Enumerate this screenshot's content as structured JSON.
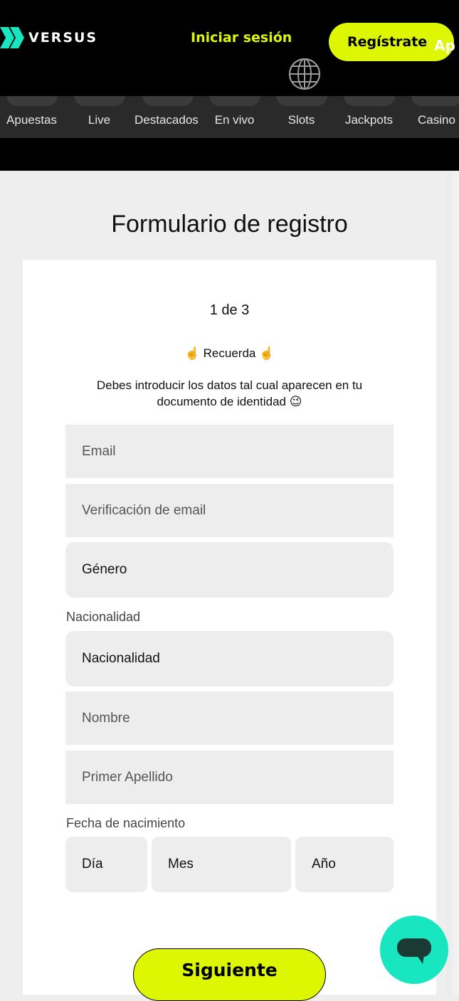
{
  "header": {
    "logo_text": "VERSUS",
    "login_label": "Iniciar sesión",
    "register_label": "Regístrate",
    "app_clip": "Ap",
    "brand_color": "#ddf702"
  },
  "nav": {
    "items": [
      {
        "label": "Apuestas"
      },
      {
        "label": "Live"
      },
      {
        "label": "Destacados"
      },
      {
        "label": "En vivo"
      },
      {
        "label": "Slots"
      },
      {
        "label": "Jackpots"
      },
      {
        "label": "Casino"
      }
    ]
  },
  "form": {
    "title": "Formulario de registro",
    "step": "1 de 3",
    "remember": "☝️ Recuerda ☝️",
    "hint": "Debes introducir los datos tal cual aparecen en tu documento de identidad 😉",
    "email_placeholder": "Email",
    "email_verify_placeholder": "Verificación de email",
    "gender_value": "Género",
    "nationality_label": "Nacionalidad",
    "nationality_value": "Nacionalidad",
    "name_placeholder": "Nombre",
    "surname_placeholder": "Primer Apellido",
    "birthdate_label": "Fecha de nacimiento",
    "day_value": "Día",
    "month_value": "Mes",
    "year_value": "Año",
    "next_label": "Siguiente"
  },
  "chat": {
    "accent_color": "#17e6c0"
  }
}
